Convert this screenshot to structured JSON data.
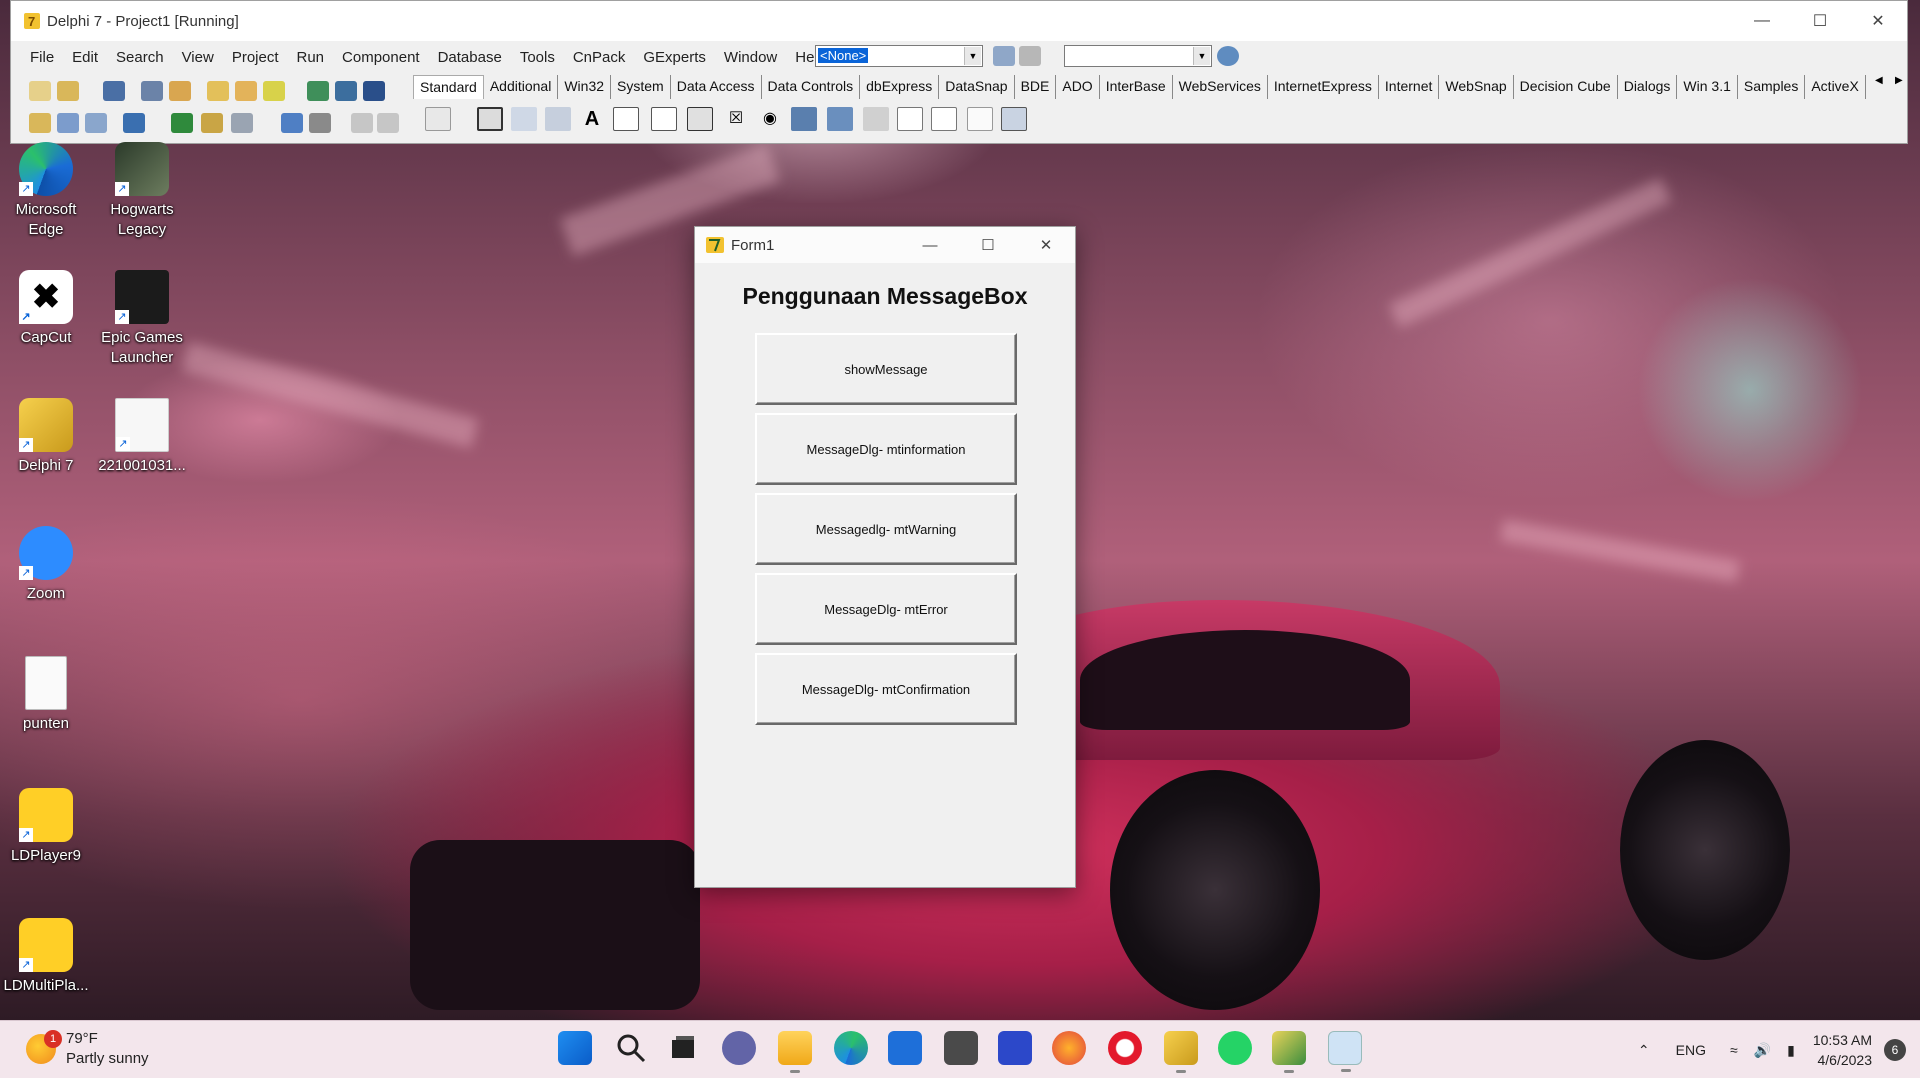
{
  "ide": {
    "title": "Delphi 7 - Project1 [Running]",
    "menu": [
      "File",
      "Edit",
      "Search",
      "View",
      "Project",
      "Run",
      "Component",
      "Database",
      "Tools",
      "CnPack",
      "GExperts",
      "Window",
      "Help"
    ],
    "desktop_combo": "<None>",
    "palette_tabs": [
      "Standard",
      "Additional",
      "Win32",
      "System",
      "Data Access",
      "Data Controls",
      "dbExpress",
      "DataSnap",
      "BDE",
      "ADO",
      "InterBase",
      "WebServices",
      "InternetExpress",
      "Internet",
      "WebSnap",
      "Decision Cube",
      "Dialogs",
      "Win 3.1",
      "Samples",
      "ActiveX"
    ]
  },
  "desktop_icons": [
    {
      "label": "Microsoft Edge",
      "icon": "edge-icon"
    },
    {
      "label": "Hogwarts Legacy",
      "icon": "hogwarts-icon"
    },
    {
      "label": "CapCut",
      "icon": "capcut-icon"
    },
    {
      "label": "Epic Games Launcher",
      "icon": "epic-games-icon"
    },
    {
      "label": "Delphi 7",
      "icon": "delphi-icon"
    },
    {
      "label": "221001031...",
      "icon": "document-icon"
    },
    {
      "label": "Zoom",
      "icon": "zoom-icon"
    },
    {
      "label": "punten",
      "icon": "text-file-icon"
    },
    {
      "label": "LDPlayer9",
      "icon": "ldplayer-icon"
    },
    {
      "label": "LDMultiPla...",
      "icon": "ldmultiplayer-icon"
    }
  ],
  "form1": {
    "title": "Form1",
    "heading": "Penggunaan MessageBox",
    "buttons": [
      "showMessage",
      "MessageDlg- mtinformation",
      "Messagedlg- mtWarning",
      "MessageDlg- mtError",
      "MessageDlg- mtConfirmation"
    ]
  },
  "taskbar": {
    "weather_temp": "79°F",
    "weather_desc": "Partly sunny",
    "weather_badge": "1",
    "language": "ENG",
    "time": "10:53 AM",
    "date": "4/6/2023",
    "notifications": "6"
  },
  "colors": {
    "accent": "#0a64d8",
    "form_bg": "#f0f0f0",
    "taskbar_bg": "#f3e6ec"
  }
}
